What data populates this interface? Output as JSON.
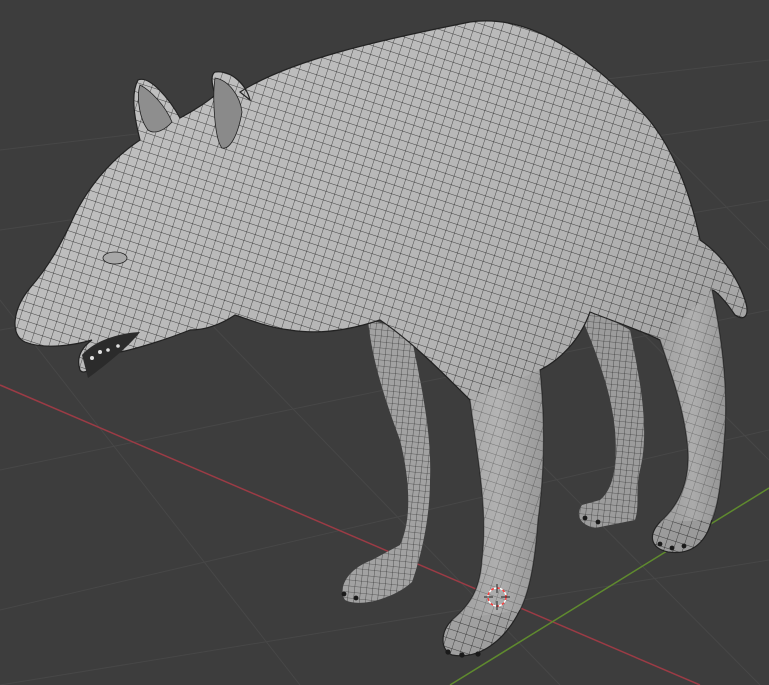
{
  "viewport": {
    "background_color": "#3d3d3d",
    "grid_color": "#474747",
    "x_axis_color": "#9b3b45",
    "y_axis_color": "#5f8a2e"
  },
  "model": {
    "surface_color": "#b9b9b9",
    "shade_color": "#8c8c8c",
    "wire_color": "#1c1c1c",
    "display": "wireframe-on-solid"
  },
  "cursor_3d": {
    "icon": "3d-cursor-icon",
    "colors": [
      "#ff3b3b",
      "#ffffff"
    ]
  }
}
